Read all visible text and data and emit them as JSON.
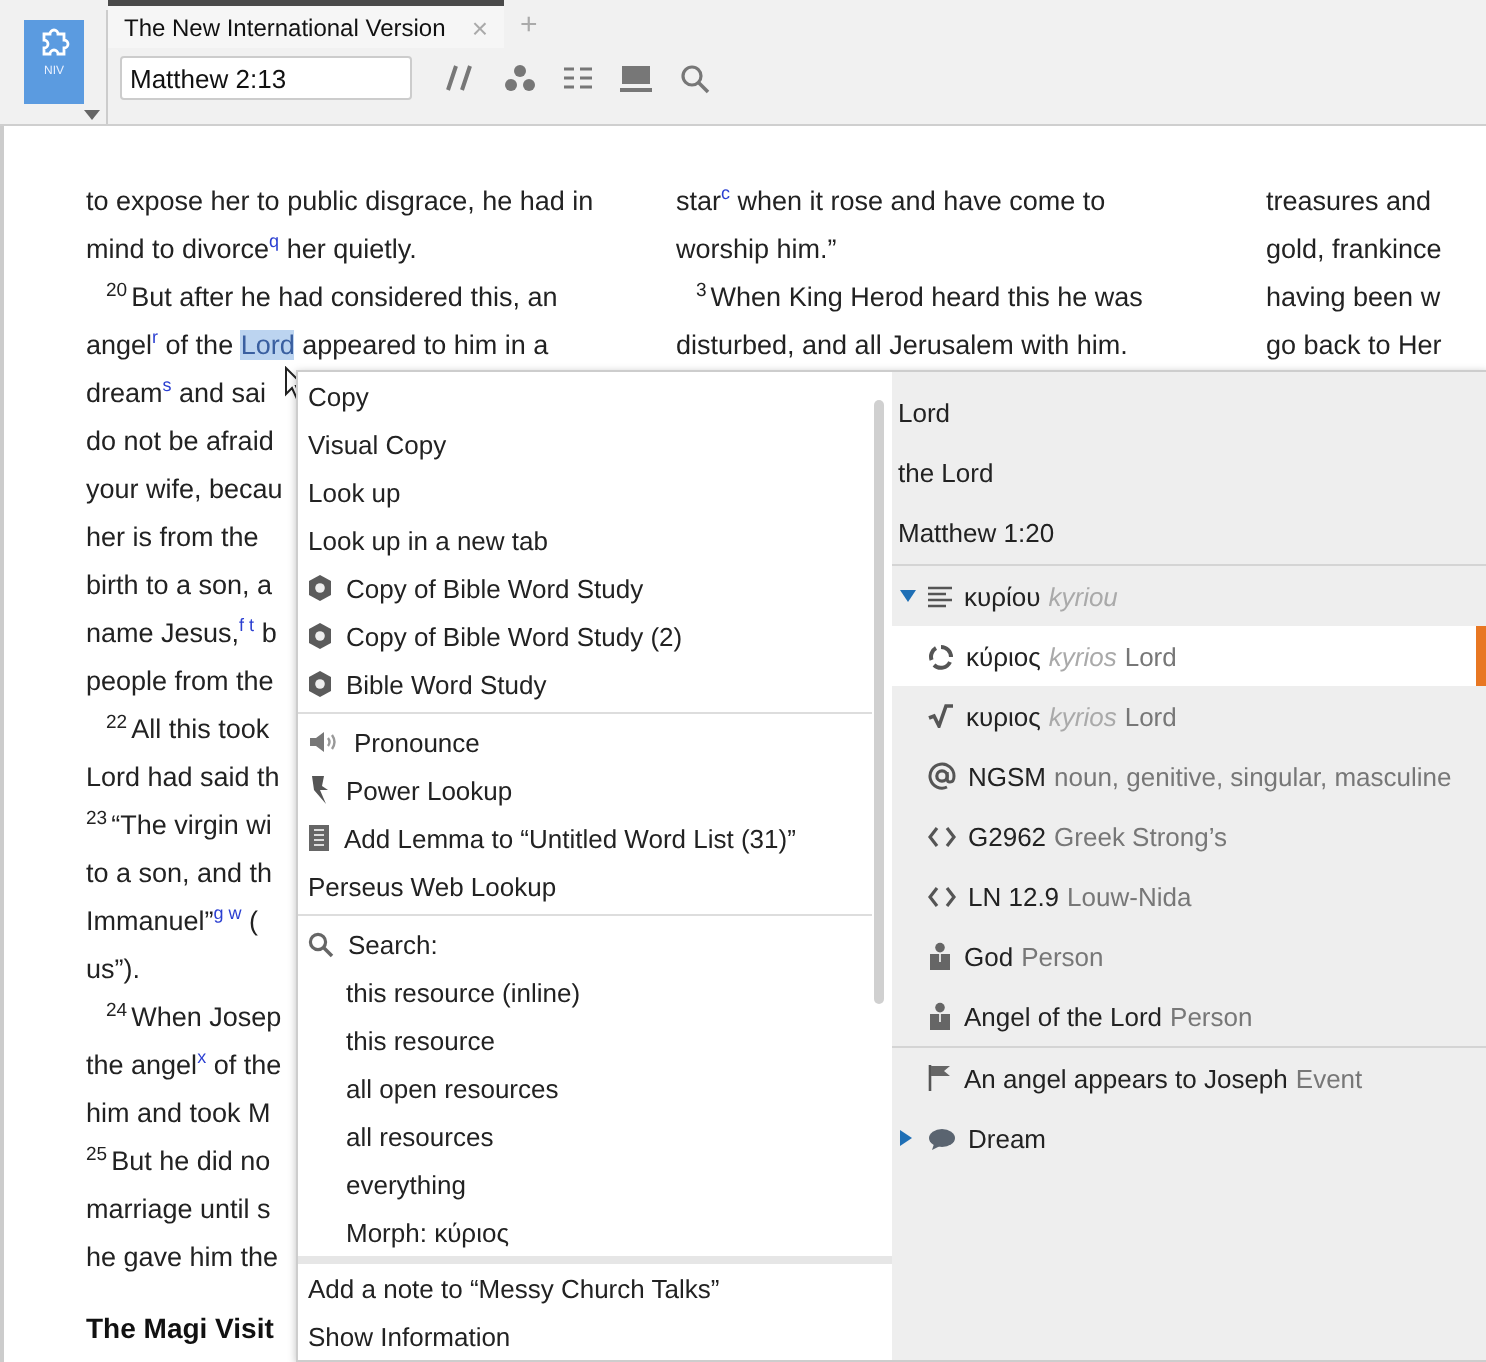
{
  "app_badge": "NIV",
  "tabs": [
    {
      "label": "The New International Version",
      "selected": true,
      "close": "×"
    }
  ],
  "new_tab": "+",
  "reference_field": {
    "value": "Matthew 2:13"
  },
  "columns": [
    {
      "lines": [
        {
          "text": "to expose her to public disgrace, he had in"
        },
        {
          "text": "mind to divorce$^{q}$ her quietly."
        },
        {
          "verse": "20",
          "indent": true,
          "text": "But after he had considered this, an"
        },
        {
          "text": "angel$^{r}$ of the ",
          "selection": "Lord",
          "rest": " appeared to him in a"
        },
        {
          "text": "dream$^{s}$ and sai"
        },
        {
          "text": "do not be afraid"
        },
        {
          "text": "your wife, becau"
        },
        {
          "text": "her is from the"
        },
        {
          "text": "birth to a son, a"
        },
        {
          "text": "name Jesus,$^{f t}$ b"
        },
        {
          "text": "people from the"
        },
        {
          "verse": "22",
          "indent": true,
          "text": "All this took"
        },
        {
          "text": "Lord had said th"
        },
        {
          "verse": "23",
          "indent": false,
          "text": "“The virgin wi"
        },
        {
          "text": "to a son, and th"
        },
        {
          "text": "Immanuel”$^{g w}$ ("
        },
        {
          "text": "us”)."
        },
        {
          "verse": "24",
          "indent": true,
          "text": "When Josep"
        },
        {
          "text": "the angel$^{x}$ of the"
        },
        {
          "text": "him and took M"
        },
        {
          "verse": "25",
          "indent": false,
          "text": "But he did no"
        },
        {
          "text": "marriage until s"
        },
        {
          "text": "he gave him the"
        }
      ],
      "heading": "The Magi Visit"
    },
    {
      "lines": [
        {
          "text": "star$^{c}$ when it rose and have come to"
        },
        {
          "text": "worship him.”"
        },
        {
          "verse": "3",
          "indent": true,
          "text": "When King Herod heard this he was"
        },
        {
          "text": "disturbed, and all Jerusalem with him."
        }
      ]
    },
    {
      "lines": [
        {
          "text": "treasures and"
        },
        {
          "text": "gold, frankince"
        },
        {
          "text": "having been w"
        },
        {
          "text": "go back to Her"
        }
      ]
    }
  ],
  "context_menu": {
    "groups": [
      [
        {
          "label": "Copy"
        },
        {
          "label": "Visual Copy"
        },
        {
          "label": "Look up"
        },
        {
          "label": "Look up in a new tab"
        },
        {
          "label": "Copy of Bible Word Study",
          "kind": "guide"
        },
        {
          "label": "Copy of Bible Word Study (2)",
          "kind": "guide"
        },
        {
          "label": "Bible Word Study",
          "kind": "guide"
        }
      ],
      [
        {
          "label": "Pronounce",
          "kind": "speaker"
        },
        {
          "label": "Power Lookup",
          "kind": "pin"
        },
        {
          "label": "Add Lemma to “Untitled Word List (31)”",
          "kind": "list"
        },
        {
          "label": "Perseus Web Lookup"
        }
      ],
      [
        {
          "label": "Search:",
          "kind": "search",
          "children": [
            {
              "label": "this resource (inline)"
            },
            {
              "label": "this resource"
            },
            {
              "label": "all open resources"
            },
            {
              "label": "all resources"
            },
            {
              "label": "everything"
            },
            {
              "label": "Morph: κύριος"
            }
          ]
        }
      ]
    ],
    "footer": [
      {
        "label": "Add a note to “Messy Church Talks”"
      },
      {
        "label": "Show Information"
      }
    ],
    "info_header": [
      "Lord",
      "the Lord",
      "Matthew 1:20"
    ],
    "info_groups": [
      [
        {
          "kind": "lines",
          "expanded": true,
          "term": "κυρίου",
          "transliteration": "kyriou",
          "selected": false
        },
        {
          "kind": "cycle",
          "term": "κύριος",
          "transliteration": "kyrios",
          "description": "Lord",
          "selected": true
        },
        {
          "kind": "root",
          "term": "κυριος",
          "transliteration": "kyrios",
          "description": "Lord",
          "selected": false
        },
        {
          "kind": "at",
          "term": "NGSM",
          "description": "noun, genitive, singular, masculine",
          "selected": false
        },
        {
          "kind": "code",
          "term": "G2962",
          "description": "Greek Strong’s",
          "selected": false
        },
        {
          "kind": "code",
          "term": "LN 12.9",
          "description": "Louw-Nida",
          "selected": false
        },
        {
          "kind": "person",
          "term": "God",
          "description": "Person",
          "selected": false
        },
        {
          "kind": "person",
          "term": "Angel of the Lord",
          "description": "Person",
          "selected": false
        }
      ],
      [
        {
          "kind": "flag",
          "term": "An angel appears to Joseph",
          "description": "Event",
          "selected": false
        },
        {
          "kind": "bubble",
          "expanded": false,
          "term": "Dream",
          "selected": false
        }
      ]
    ]
  }
}
